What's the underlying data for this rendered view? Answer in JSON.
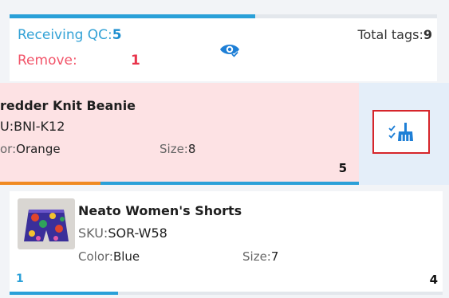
{
  "colors": {
    "accent": "#2aa0d8",
    "remove": "#e8344b",
    "highlight_card": "#fde2e4",
    "action_panel": "#e4eef9",
    "progress_orange": "#f08a22"
  },
  "summary": {
    "receiving_label": "Receiving QC:",
    "receiving_value": "5",
    "remove_label": "Remove:",
    "remove_value": "1",
    "total_label": "Total tags:",
    "total_value": "9",
    "view_icon": "eye-check-icon",
    "progress_fraction": 0.575
  },
  "items": [
    {
      "title": "redder Knit Beanie",
      "sku_label": "U:",
      "sku_value": "BNI-K12",
      "color_label": "or:",
      "color_value": "Orange",
      "size_label": "Size:",
      "size_value": "8",
      "count": "5",
      "progress_fraction": 0.28,
      "action_icon": "broom-clean-icon"
    },
    {
      "title": "Neato Women's Shorts",
      "sku_label": "SKU:",
      "sku_value": "SOR-W58",
      "color_label": "Color:",
      "color_value": "Blue",
      "size_label": "Size:",
      "size_value": "7",
      "scanned": "1",
      "count": "4",
      "progress_fraction": 0.25
    }
  ]
}
